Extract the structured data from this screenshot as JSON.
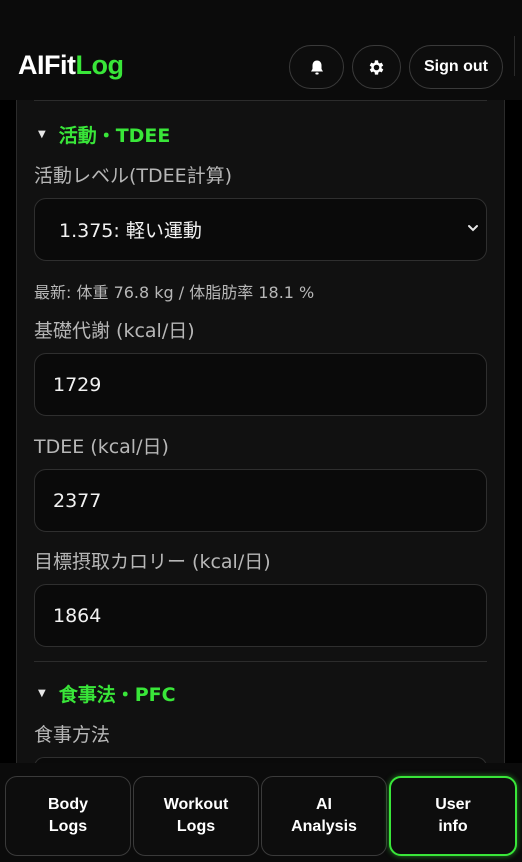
{
  "app": {
    "logo_part1": "AIFit",
    "logo_part2": "Log"
  },
  "header": {
    "sign_out_label": "Sign out"
  },
  "sections": {
    "activity": {
      "title": "活動・TDEE",
      "activity_level_label": "活動レベル(TDEE計算)",
      "activity_level_value": "1.375: 軽い運動",
      "latest_info": "最新: 体重 76.8 kg / 体脂肪率 18.1 %",
      "bmr_label": "基礎代謝 (kcal/日)",
      "bmr_value": "1729",
      "tdee_label": "TDEE (kcal/日)",
      "tdee_value": "2377",
      "target_label": "目標摂取カロリー (kcal/日)",
      "target_value": "1864"
    },
    "diet": {
      "title": "食事法・PFC",
      "method_label": "食事方法"
    }
  },
  "nav": {
    "items": [
      {
        "label": "Body\nLogs"
      },
      {
        "label": "Workout\nLogs"
      },
      {
        "label": "AI\nAnalysis"
      },
      {
        "label": "User\ninfo"
      }
    ]
  },
  "colors": {
    "accent": "#39e639",
    "background": "#000000",
    "panel": "#111111"
  }
}
